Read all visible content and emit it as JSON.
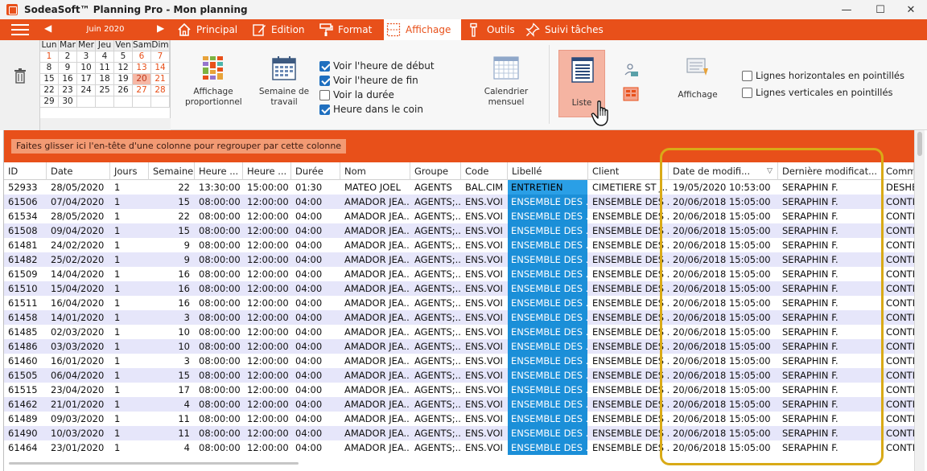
{
  "window": {
    "title": "SodeaSoft™ Planning Pro - Mon planning",
    "minimize": "—",
    "maximize": "☐",
    "close": "✕"
  },
  "tabs": [
    {
      "label": "Principal",
      "icon": "home-icon"
    },
    {
      "label": "Edition",
      "icon": "edit-icon"
    },
    {
      "label": "Format",
      "icon": "paint-roller-icon"
    },
    {
      "label": "Affichage",
      "icon": "display-grid-icon",
      "active": true
    },
    {
      "label": "Outils",
      "icon": "tools-icon"
    },
    {
      "label": "Suivi tâches",
      "icon": "pin-icon"
    }
  ],
  "calendar": {
    "month": "Juin 2020",
    "prev": "◀",
    "next": "▶",
    "days": [
      "Lun",
      "Mar",
      "Mer",
      "Jeu",
      "Ven",
      "Sam",
      "Dim"
    ],
    "weeks": [
      [
        "1",
        "2",
        "3",
        "4",
        "5",
        "6",
        "7"
      ],
      [
        "8",
        "9",
        "10",
        "11",
        "12",
        "13",
        "14"
      ],
      [
        "15",
        "16",
        "17",
        "18",
        "19",
        "20",
        "21"
      ],
      [
        "22",
        "23",
        "24",
        "25",
        "26",
        "27",
        "28"
      ],
      [
        "29",
        "30",
        "",
        "",
        "",
        "",
        ""
      ]
    ],
    "today": "20"
  },
  "ribbon": {
    "affichage_prop": "Affichage proportionnel",
    "semaine_travail": "Semaine de travail",
    "checks": [
      {
        "label": "Voir l'heure de début",
        "checked": true
      },
      {
        "label": "Voir l'heure de fin",
        "checked": true
      },
      {
        "label": "Voir la durée",
        "checked": false
      },
      {
        "label": "Heure dans le coin",
        "checked": true
      }
    ],
    "calendrier_mensuel": "Calendrier mensuel",
    "liste": "Liste",
    "affichage": "Affichage",
    "lines": [
      {
        "label": "Lignes horizontales en pointillés",
        "checked": false
      },
      {
        "label": "Lignes verticales en pointillés",
        "checked": false
      }
    ]
  },
  "grid": {
    "group_hint": "Faites glisser ici l'en-tête d'une colonne pour regrouper par cette colonne",
    "sort_glyph": "▽",
    "columns": [
      "ID",
      "Date",
      "Jours",
      "Semaine",
      "Heure ...",
      "Heure ...",
      "Durée",
      "Nom",
      "Groupe",
      "Code",
      "Libellé",
      "Client",
      "Date de modifi...",
      "Dernière modificat...",
      "Comm"
    ],
    "rows": [
      [
        "52933",
        "28/05/2020",
        "1",
        "22",
        "13:30:00",
        "15:00:00",
        "01:30",
        "MATEO JOEL",
        "AGENTS",
        "BAL.CIM",
        "ENTRETIEN",
        "CIMETIERE ST J...",
        "19/05/2020 10:53:00",
        "SERAPHIN F.",
        "DESHE"
      ],
      [
        "61506",
        "07/04/2020",
        "1",
        "15",
        "08:00:00",
        "12:00:00",
        "04:00",
        "AMADOR JEA...",
        "AGENTS;...",
        "ENS.VOI",
        "ENSEMBLE DES ...",
        "ENSEMBLE DES ...",
        "20/06/2018 15:05:00",
        "SERAPHIN F.",
        "CONTR"
      ],
      [
        "61534",
        "28/05/2020",
        "1",
        "22",
        "08:00:00",
        "12:00:00",
        "04:00",
        "AMADOR JEA...",
        "AGENTS;...",
        "ENS.VOI",
        "ENSEMBLE DES ...",
        "ENSEMBLE DES ...",
        "20/06/2018 15:05:00",
        "SERAPHIN F.",
        "CONTR"
      ],
      [
        "61508",
        "09/04/2020",
        "1",
        "15",
        "08:00:00",
        "12:00:00",
        "04:00",
        "AMADOR JEA...",
        "AGENTS;...",
        "ENS.VOI",
        "ENSEMBLE DES ...",
        "ENSEMBLE DES ...",
        "20/06/2018 15:05:00",
        "SERAPHIN F.",
        "CONTR"
      ],
      [
        "61481",
        "24/02/2020",
        "1",
        "9",
        "08:00:00",
        "12:00:00",
        "04:00",
        "AMADOR JEA...",
        "AGENTS;...",
        "ENS.VOI",
        "ENSEMBLE DES ...",
        "ENSEMBLE DES ...",
        "20/06/2018 15:05:00",
        "SERAPHIN F.",
        "CONTR"
      ],
      [
        "61482",
        "25/02/2020",
        "1",
        "9",
        "08:00:00",
        "12:00:00",
        "04:00",
        "AMADOR JEA...",
        "AGENTS;...",
        "ENS.VOI",
        "ENSEMBLE DES ...",
        "ENSEMBLE DES ...",
        "20/06/2018 15:05:00",
        "SERAPHIN F.",
        "CONTR"
      ],
      [
        "61509",
        "14/04/2020",
        "1",
        "16",
        "08:00:00",
        "12:00:00",
        "04:00",
        "AMADOR JEA...",
        "AGENTS;...",
        "ENS.VOI",
        "ENSEMBLE DES ...",
        "ENSEMBLE DES ...",
        "20/06/2018 15:05:00",
        "SERAPHIN F.",
        "CONTR"
      ],
      [
        "61510",
        "15/04/2020",
        "1",
        "16",
        "08:00:00",
        "12:00:00",
        "04:00",
        "AMADOR JEA...",
        "AGENTS;...",
        "ENS.VOI",
        "ENSEMBLE DES ...",
        "ENSEMBLE DES ...",
        "20/06/2018 15:05:00",
        "SERAPHIN F.",
        "CONTR"
      ],
      [
        "61511",
        "16/04/2020",
        "1",
        "16",
        "08:00:00",
        "12:00:00",
        "04:00",
        "AMADOR JEA...",
        "AGENTS;...",
        "ENS.VOI",
        "ENSEMBLE DES ...",
        "ENSEMBLE DES ...",
        "20/06/2018 15:05:00",
        "SERAPHIN F.",
        "CONTR"
      ],
      [
        "61458",
        "14/01/2020",
        "1",
        "3",
        "08:00:00",
        "12:00:00",
        "04:00",
        "AMADOR JEA...",
        "AGENTS;...",
        "ENS.VOI",
        "ENSEMBLE DES ...",
        "ENSEMBLE DES ...",
        "20/06/2018 15:05:00",
        "SERAPHIN F.",
        "CONTR"
      ],
      [
        "61485",
        "02/03/2020",
        "1",
        "10",
        "08:00:00",
        "12:00:00",
        "04:00",
        "AMADOR JEA...",
        "AGENTS;...",
        "ENS.VOI",
        "ENSEMBLE DES ...",
        "ENSEMBLE DES ...",
        "20/06/2018 15:05:00",
        "SERAPHIN F.",
        "CONTR"
      ],
      [
        "61486",
        "03/03/2020",
        "1",
        "10",
        "08:00:00",
        "12:00:00",
        "04:00",
        "AMADOR JEA...",
        "AGENTS;...",
        "ENS.VOI",
        "ENSEMBLE DES ...",
        "ENSEMBLE DES ...",
        "20/06/2018 15:05:00",
        "SERAPHIN F.",
        "CONTR"
      ],
      [
        "61460",
        "16/01/2020",
        "1",
        "3",
        "08:00:00",
        "12:00:00",
        "04:00",
        "AMADOR JEA...",
        "AGENTS;...",
        "ENS.VOI",
        "ENSEMBLE DES ...",
        "ENSEMBLE DES ...",
        "20/06/2018 15:05:00",
        "SERAPHIN F.",
        "CONTR"
      ],
      [
        "61505",
        "06/04/2020",
        "1",
        "15",
        "08:00:00",
        "12:00:00",
        "04:00",
        "AMADOR JEA...",
        "AGENTS;...",
        "ENS.VOI",
        "ENSEMBLE DES ...",
        "ENSEMBLE DES ...",
        "20/06/2018 15:05:00",
        "SERAPHIN F.",
        "CONTR"
      ],
      [
        "61515",
        "23/04/2020",
        "1",
        "17",
        "08:00:00",
        "12:00:00",
        "04:00",
        "AMADOR JEA...",
        "AGENTS;...",
        "ENS.VOI",
        "ENSEMBLE DES ...",
        "ENSEMBLE DES ...",
        "20/06/2018 15:05:00",
        "SERAPHIN F.",
        "CONTR"
      ],
      [
        "61462",
        "21/01/2020",
        "1",
        "4",
        "08:00:00",
        "12:00:00",
        "04:00",
        "AMADOR JEA...",
        "AGENTS;...",
        "ENS.VOI",
        "ENSEMBLE DES ...",
        "ENSEMBLE DES ...",
        "20/06/2018 15:05:00",
        "SERAPHIN F.",
        "CONTR"
      ],
      [
        "61489",
        "09/03/2020",
        "1",
        "11",
        "08:00:00",
        "12:00:00",
        "04:00",
        "AMADOR JEA...",
        "AGENTS;...",
        "ENS.VOI",
        "ENSEMBLE DES ...",
        "ENSEMBLE DES ...",
        "20/06/2018 15:05:00",
        "SERAPHIN F.",
        "CONTR"
      ],
      [
        "61490",
        "10/03/2020",
        "1",
        "11",
        "08:00:00",
        "12:00:00",
        "04:00",
        "AMADOR JEA...",
        "AGENTS;...",
        "ENS.VOI",
        "ENSEMBLE DES ...",
        "ENSEMBLE DES ...",
        "20/06/2018 15:05:00",
        "SERAPHIN F.",
        "CONTR"
      ],
      [
        "61464",
        "23/01/2020",
        "1",
        "4",
        "08:00:00",
        "12:00:00",
        "04:00",
        "AMADOR JEA...",
        "AGENTS;...",
        "ENS.VOI",
        "ENSEMBLE DES ...",
        "ENSEMBLE DES ...",
        "20/06/2018 15:05:00",
        "SERAPHIN F.",
        "CONTR"
      ]
    ]
  },
  "colors": {
    "accent": "#e8501a",
    "libelle_blue": "#1b8fd8",
    "row_alt": "#e6e6fa",
    "highlight": "#d9aa17"
  }
}
